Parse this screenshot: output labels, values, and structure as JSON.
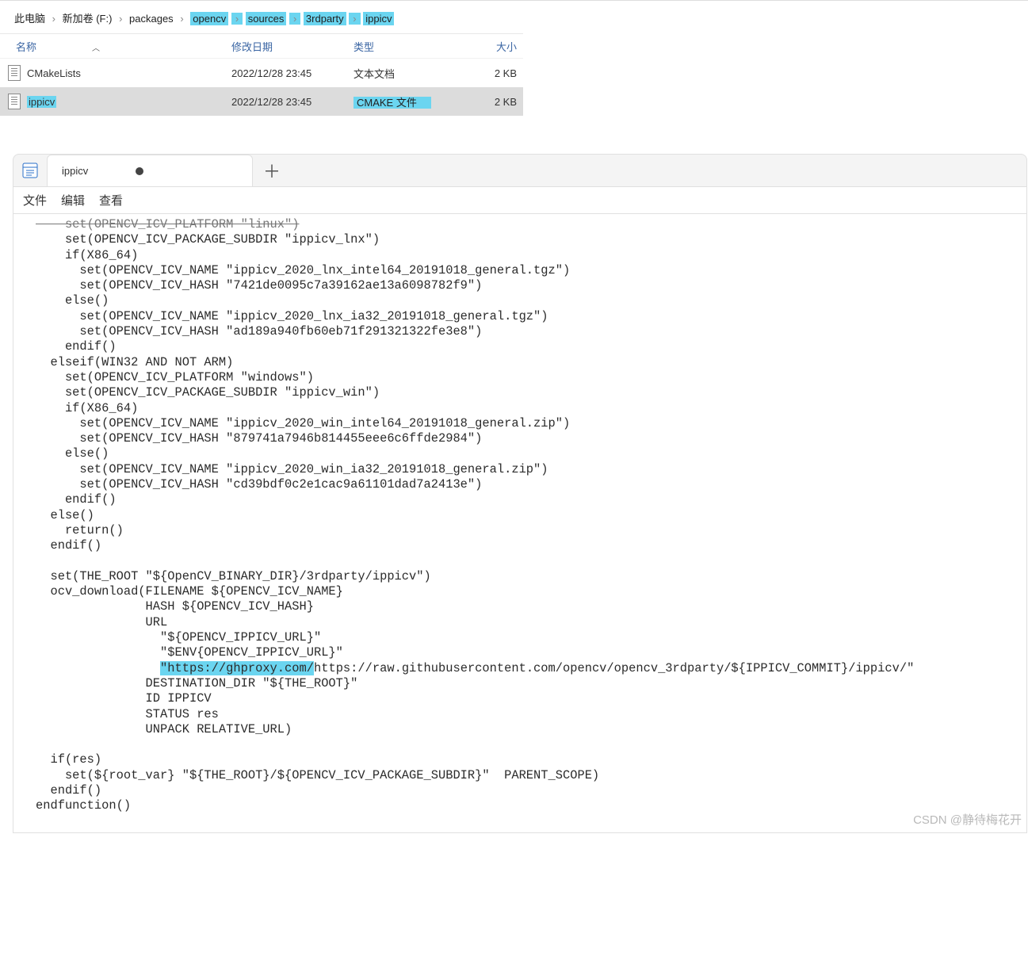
{
  "explorer": {
    "breadcrumb": {
      "items": [
        {
          "label": "此电脑",
          "hl": false
        },
        {
          "label": "新加卷 (F:)",
          "hl": false
        },
        {
          "label": "packages",
          "hl": false
        },
        {
          "label": "opencv",
          "hl": true
        },
        {
          "label": "sources",
          "hl": true
        },
        {
          "label": "3rdparty",
          "hl": true
        },
        {
          "label": "ippicv    ",
          "hl": true
        }
      ],
      "sep": "›"
    },
    "columns": {
      "name": "名称",
      "date": "修改日期",
      "type": "类型",
      "size": "大小"
    },
    "rows": [
      {
        "name": "CMakeLists",
        "name_hl": false,
        "date": "2022/12/28 23:45",
        "type": "文本文档",
        "type_hl": false,
        "size": "2 KB"
      },
      {
        "name": "ippicv",
        "name_hl": true,
        "date": "2022/12/28 23:45",
        "type": "CMAKE 文件",
        "type_hl": true,
        "size": "2 KB"
      }
    ]
  },
  "notepad": {
    "tab_label": "ippicv",
    "menu": {
      "file": "文件",
      "edit": "编辑",
      "view": "查看"
    },
    "code": {
      "l00": "    set(OPENCV_ICV_PLATFORM \"linux\")",
      "l01": "    set(OPENCV_ICV_PACKAGE_SUBDIR \"ippicv_lnx\")",
      "l02": "    if(X86_64)",
      "l03": "      set(OPENCV_ICV_NAME \"ippicv_2020_lnx_intel64_20191018_general.tgz\")",
      "l04": "      set(OPENCV_ICV_HASH \"7421de0095c7a39162ae13a6098782f9\")",
      "l05": "    else()",
      "l06": "      set(OPENCV_ICV_NAME \"ippicv_2020_lnx_ia32_20191018_general.tgz\")",
      "l07": "      set(OPENCV_ICV_HASH \"ad189a940fb60eb71f291321322fe3e8\")",
      "l08": "    endif()",
      "l09": "  elseif(WIN32 AND NOT ARM)",
      "l10": "    set(OPENCV_ICV_PLATFORM \"windows\")",
      "l11": "    set(OPENCV_ICV_PACKAGE_SUBDIR \"ippicv_win\")",
      "l12": "    if(X86_64)",
      "l13": "      set(OPENCV_ICV_NAME \"ippicv_2020_win_intel64_20191018_general.zip\")",
      "l14": "      set(OPENCV_ICV_HASH \"879741a7946b814455eee6c6ffde2984\")",
      "l15": "    else()",
      "l16": "      set(OPENCV_ICV_NAME \"ippicv_2020_win_ia32_20191018_general.zip\")",
      "l17": "      set(OPENCV_ICV_HASH \"cd39bdf0c2e1cac9a61101dad7a2413e\")",
      "l18": "    endif()",
      "l19": "  else()",
      "l20": "    return()",
      "l21": "  endif()",
      "l22": "",
      "l23": "  set(THE_ROOT \"${OpenCV_BINARY_DIR}/3rdparty/ippicv\")",
      "l24": "  ocv_download(FILENAME ${OPENCV_ICV_NAME}",
      "l25": "               HASH ${OPENCV_ICV_HASH}",
      "l26": "               URL",
      "l27": "                 \"${OPENCV_IPPICV_URL}\"",
      "l28": "                 \"$ENV{OPENCV_IPPICV_URL}\"",
      "l29a": "                 ",
      "l29h": "\"https://ghproxy.com/",
      "l29b": "https://raw.githubusercontent.com/opencv/opencv_3rdparty/${IPPICV_COMMIT}/ippicv/\"",
      "l30": "               DESTINATION_DIR \"${THE_ROOT}\"",
      "l31": "               ID IPPICV",
      "l32": "               STATUS res",
      "l33": "               UNPACK RELATIVE_URL)",
      "l34": "",
      "l35": "  if(res)",
      "l36": "    set(${root_var} \"${THE_ROOT}/${OPENCV_ICV_PACKAGE_SUBDIR}\"  PARENT_SCOPE)",
      "l37": "  endif()",
      "l38": "endfunction()"
    }
  },
  "watermark": "CSDN @静待梅花开"
}
